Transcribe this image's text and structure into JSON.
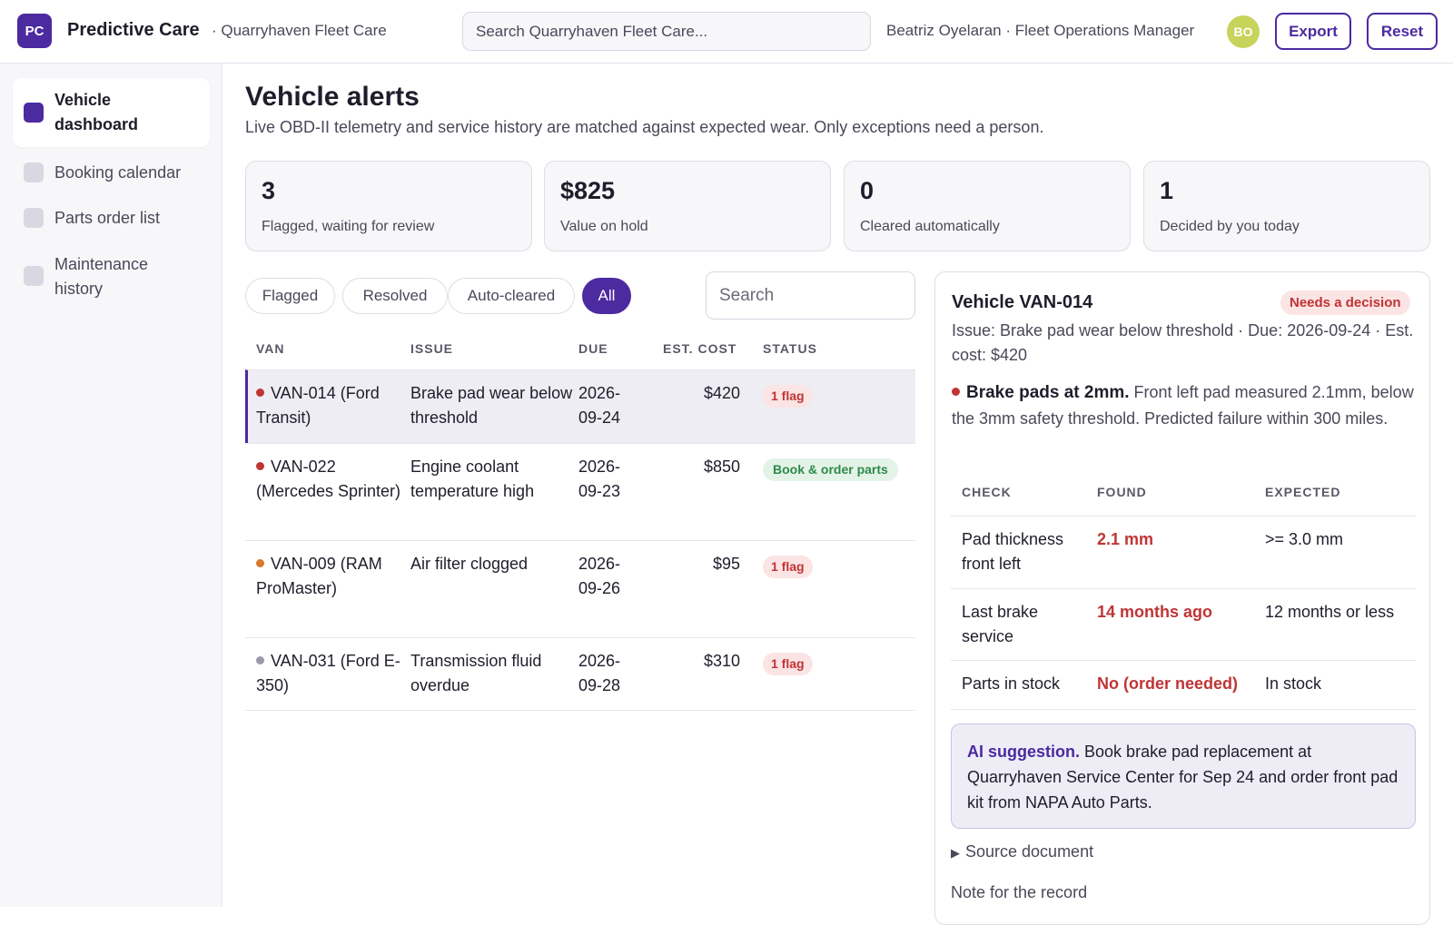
{
  "app": {
    "logo_text": "PC",
    "brand": "Predictive Care",
    "org": "· Quarryhaven Fleet Care",
    "search_placeholder": "Search Quarryhaven Fleet Care...",
    "user": "Beatriz Oyelaran · Fleet Operations Manager",
    "avatar_initials": "BO",
    "export_label": "Export",
    "reset_label": "Reset"
  },
  "sidebar": {
    "items": [
      {
        "label": "Vehicle dashboard",
        "active": true
      },
      {
        "label": "Booking calendar",
        "active": false
      },
      {
        "label": "Parts order list",
        "active": false
      },
      {
        "label": "Maintenance history",
        "active": false
      }
    ]
  },
  "page": {
    "title": "Vehicle alerts",
    "subtitle": "Live OBD-II telemetry and service history are matched against expected wear. Only exceptions need a person."
  },
  "kpis": [
    {
      "value": "3",
      "label": "Flagged, waiting for review"
    },
    {
      "value": "$825",
      "label": "Value on hold"
    },
    {
      "value": "0",
      "label": "Cleared automatically"
    },
    {
      "value": "1",
      "label": "Decided by you today"
    }
  ],
  "filters": {
    "chips": [
      "Flagged",
      "Resolved",
      "Auto-cleared",
      "All"
    ],
    "active": "All",
    "search_placeholder": "Search"
  },
  "table": {
    "headers": [
      "VAN",
      "ISSUE",
      "DUE",
      "EST. COST",
      "STATUS"
    ],
    "rows": [
      {
        "van": "VAN-014 (Ford Transit)",
        "issue": "Brake pad wear below threshold",
        "due": "2026-09-24",
        "cost": "$420",
        "status": "1 flag",
        "dot_color": "#c03434"
      },
      {
        "van": "VAN-022 (Mercedes Sprinter)",
        "issue": "Engine coolant temperature high",
        "due": "2026-09-23",
        "cost": "$850",
        "status": "Book & order parts",
        "dot_color": "#c03434"
      },
      {
        "van": "VAN-009 (RAM ProMaster)",
        "issue": "Air filter clogged",
        "due": "2026-09-26",
        "cost": "$95",
        "status": "1 flag",
        "dot_color": "#d9772a"
      },
      {
        "van": "VAN-031 (Ford E-350)",
        "issue": "Transmission fluid overdue",
        "due": "2026-09-28",
        "cost": "$310",
        "status": "1 flag",
        "dot_color": "#9b99ab"
      }
    ]
  },
  "detail": {
    "title": "Vehicle VAN-014",
    "badge": "Needs a decision",
    "meta": "Issue: Brake pad wear below threshold · Due: 2026-09-24 · Est. cost: $420",
    "headline": "Brake pads at 2mm.",
    "description": "Front left pad measured 2.1mm, below the 3mm safety threshold. Predicted failure within 300 miles.",
    "checks_headers": [
      "CHECK",
      "FOUND",
      "EXPECTED"
    ],
    "checks": [
      {
        "check": "Pad thickness front left",
        "found": "2.1 mm",
        "expected": ">= 3.0 mm"
      },
      {
        "check": "Last brake service",
        "found": "14 months ago",
        "expected": "12 months or less"
      },
      {
        "check": "Parts in stock",
        "found": "No (order needed)",
        "expected": "In stock"
      }
    ],
    "ai_heading": "AI suggestion.",
    "ai_text": "Book brake pad replacement at Quarryhaven Service Center for Sep 24 and order front pad kit from NAPA Auto Parts.",
    "source_label": "Source document",
    "note_label": "Note for the record"
  },
  "colors": {
    "accent": "#4c2aa0",
    "danger": "#c03434",
    "success": "#2d8a4a",
    "warning": "#d9772a"
  }
}
